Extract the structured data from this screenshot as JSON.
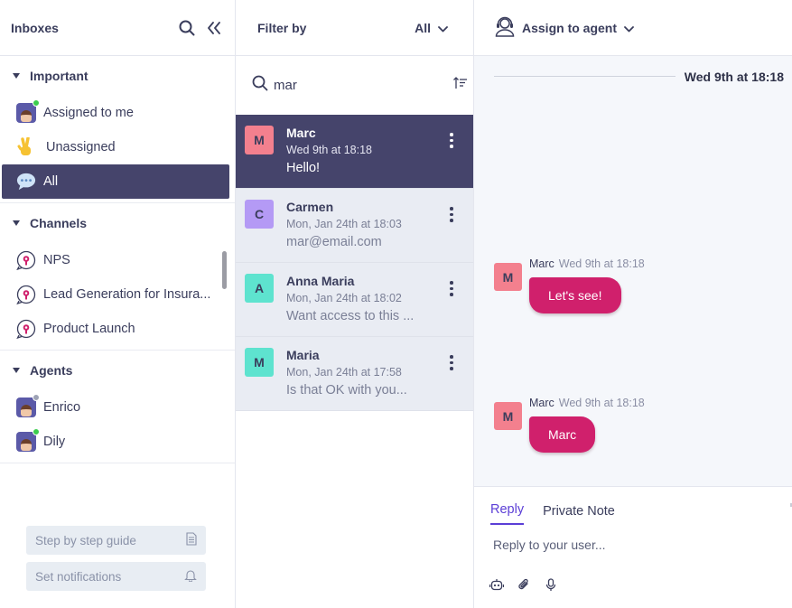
{
  "sidebar": {
    "title": "Inboxes",
    "sections": [
      {
        "label": "Important",
        "items": [
          {
            "label": "Assigned to me",
            "icon": "agent-avatar-icon",
            "status": "online"
          },
          {
            "label": "Unassigned",
            "icon": "victory-hand-icon"
          },
          {
            "label": "All",
            "icon": "speech-bubble-icon",
            "active": true
          }
        ]
      },
      {
        "label": "Channels",
        "items": [
          {
            "label": "NPS",
            "icon": "channel-chat-icon"
          },
          {
            "label": "Lead Generation for Insura...",
            "icon": "channel-chat-icon"
          },
          {
            "label": "Product Launch",
            "icon": "channel-chat-icon"
          }
        ]
      },
      {
        "label": "Agents",
        "items": [
          {
            "label": "Enrico",
            "icon": "agent-avatar-icon",
            "status": "offline"
          },
          {
            "label": "Dily",
            "icon": "agent-avatar-icon",
            "status": "online"
          }
        ]
      }
    ],
    "guide_label": "Step by step guide",
    "notifications_label": "Set notifications"
  },
  "list": {
    "filter_label": "Filter by",
    "filter_value": "All",
    "search_value": "mar",
    "conversations": [
      {
        "initial": "M",
        "name": "Marc",
        "time": "Wed 9th at 18:18",
        "preview": "Hello!",
        "color": "#f3808e",
        "active": true
      },
      {
        "initial": "C",
        "name": "Carmen",
        "time": "Mon, Jan 24th at 18:03",
        "preview": "mar@email.com",
        "color": "#b49af5"
      },
      {
        "initial": "A",
        "name": "Anna Maria",
        "time": "Mon, Jan 24th at 18:02",
        "preview": "Want access to this ...",
        "color": "#5ee3cf"
      },
      {
        "initial": "M",
        "name": "Maria",
        "time": "Mon, Jan 24th at 17:58",
        "preview": "Is that OK with you...",
        "color": "#5ee3cf"
      }
    ]
  },
  "chat": {
    "assign_label": "Assign to agent",
    "date_separator": "Wed 9th at 18:18",
    "messages": [
      {
        "initial": "M",
        "author": "Marc",
        "time": "Wed 9th at 18:18",
        "text": "Let's see!"
      },
      {
        "initial": "M",
        "author": "Marc",
        "time": "Wed 9th at 18:18",
        "text": "Marc"
      }
    ],
    "tabs": [
      "Reply",
      "Private Note"
    ],
    "reply_placeholder": "Reply to your user..."
  },
  "colors": {
    "accent_dark": "#45446b",
    "bubble": "#d0206c",
    "tab_active": "#5b3ed6",
    "online": "#3ccd4e"
  }
}
